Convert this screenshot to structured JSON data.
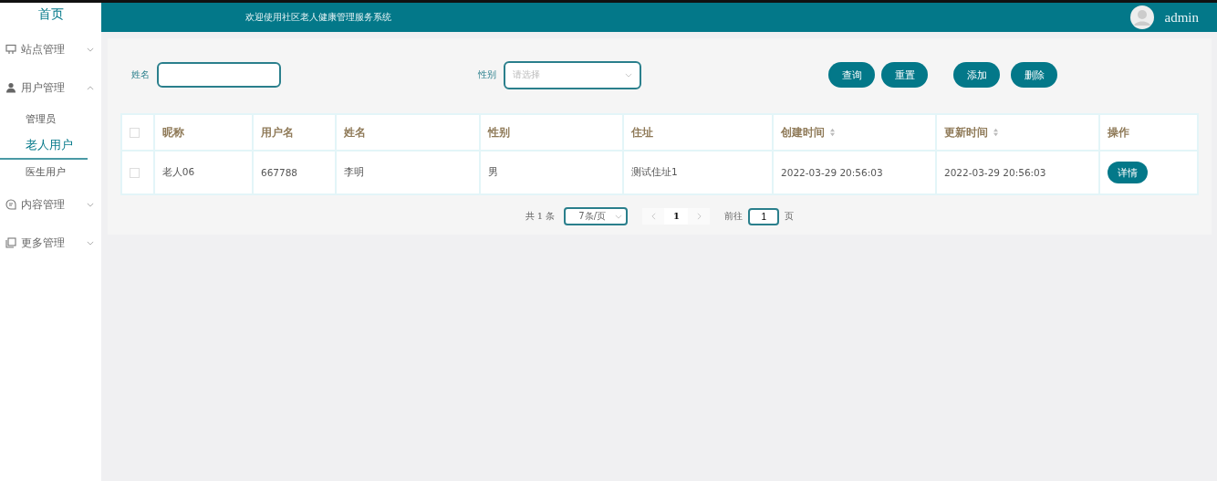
{
  "sidebar": {
    "home": "首页",
    "menus": [
      {
        "label": "站点管理",
        "expanded": false
      },
      {
        "label": "用户管理",
        "expanded": true,
        "children": [
          {
            "label": "管理员",
            "selected": false
          },
          {
            "label": "老人用户",
            "selected": true
          },
          {
            "label": "医生用户",
            "selected": false
          }
        ]
      },
      {
        "label": "内容管理",
        "expanded": false
      },
      {
        "label": "更多管理",
        "expanded": false
      }
    ]
  },
  "header": {
    "title": "欢迎使用社区老人健康管理服务系统",
    "user": "admin"
  },
  "search": {
    "name_label": "姓名",
    "gender_label": "性别",
    "gender_placeholder": "请选择",
    "buttons": [
      "查询",
      "重置"
    ],
    "actions": [
      "添加",
      "删除"
    ]
  },
  "table": {
    "all_checked": false,
    "columns": [
      {
        "label": "昵称",
        "sortable": false
      },
      {
        "label": "用户名",
        "sortable": false
      },
      {
        "label": "姓名",
        "sortable": false
      },
      {
        "label": "性别",
        "sortable": false
      },
      {
        "label": "住址",
        "sortable": false
      },
      {
        "label": "创建时间",
        "sortable": true
      },
      {
        "label": "更新时间",
        "sortable": true
      },
      {
        "label": "操作",
        "sortable": false
      }
    ],
    "rows": [
      {
        "checked": false,
        "cells": [
          "老人06",
          "667788",
          "李明",
          "男",
          "测试住址1",
          "2022-03-29 20:56:03",
          "2022-03-29 20:56:03"
        ],
        "action": "详情"
      }
    ]
  },
  "pagination": {
    "total": "共 1 条",
    "page_size": "7条/页",
    "pages": [
      {
        "label": "1",
        "selected": true
      }
    ],
    "goto_label": "前往",
    "goto_value": "1",
    "page_suffix": "页"
  }
}
